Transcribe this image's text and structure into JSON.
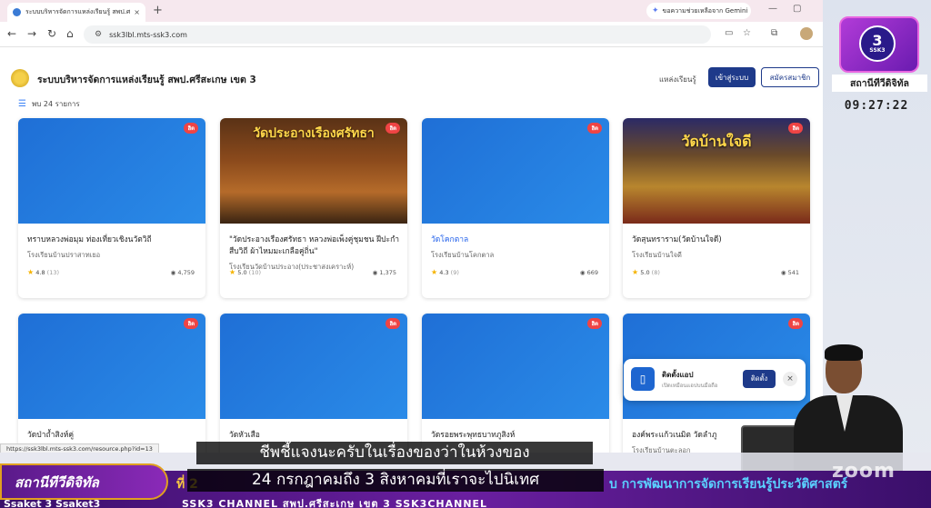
{
  "browser": {
    "tab_title": "ระบบบริหารจัดการแหล่งเรียนรู้ สพป.ศ",
    "tab_close": "×",
    "new_tab": "+",
    "gemini_label": "ขอความช่วยเหลือจาก Gemini",
    "url": "ssk3lbl.mts-ssk3.com",
    "status_url": "https://ssk3lbl.mts-ssk3.com/resource.php?id=13"
  },
  "site": {
    "title": "ระบบบริหารจัดการแหล่งเรียนรู้ สพป.ศรีสะเกษ เขต 3",
    "nav_link": "แหล่งเรียนรู้",
    "login_label": "เข้าสู่ระบบ",
    "register_label": "สมัครสมาชิก",
    "result_count": "พบ 24 รายการ"
  },
  "cards": [
    {
      "badge": "ฮิต",
      "name": "ทราบหลวงพ่อมุม ท่องเที่ยวเชิงนวัตวิถี",
      "school": "โรงเรียนบ้านปราสาทเยอ",
      "rating": "4.8",
      "reviews": "(13)",
      "views": "4,759",
      "poster": ""
    },
    {
      "badge": "ฮิต",
      "name": "\"วัดประอางเรืองศรัทธา หลวงพ่อเพ็งคู่ชุมชน ฝีปะกำสืบวิถี ผ้าไหมมะเกลือคู่ถิ่น\"",
      "school": "โรงเรียนวัดบ้านประอาง(ประชาสงเคราะห์)",
      "rating": "5.0",
      "reviews": "(10)",
      "views": "1,375",
      "poster": "วัดประอางเรืองศรัทธา"
    },
    {
      "badge": "ฮิต",
      "name": "วัดโคกตาล",
      "school": "โรงเรียนบ้านโคกตาล",
      "rating": "4.3",
      "reviews": "(9)",
      "views": "669",
      "poster": ""
    },
    {
      "badge": "ฮิต",
      "name": "วัดสุนทราราม(วัดบ้านใจดี)",
      "school": "โรงเรียนบ้านใจดี",
      "rating": "5.0",
      "reviews": "(8)",
      "views": "541",
      "poster": "วัดบ้านใจดี"
    },
    {
      "badge": "ฮิต",
      "name": "วัดป่าถ้ำสิงห์คู่",
      "school": "",
      "rating": "",
      "reviews": "",
      "views": "",
      "poster": ""
    },
    {
      "badge": "ฮิต",
      "name": "วัดหัวเสือ",
      "school": "",
      "rating": "",
      "reviews": "",
      "views": "",
      "poster": ""
    },
    {
      "badge": "ฮิต",
      "name": "วัดรอยพระพุทธบาทภูสิงห์",
      "school": "",
      "rating": "",
      "reviews": "",
      "views": "",
      "poster": ""
    },
    {
      "badge": "ฮิต",
      "name": "องค์พระแก้วเนมิต วัดลำภู",
      "school": "โรงเรียนบ้านตะลอก",
      "rating": "",
      "reviews": "",
      "views": "",
      "poster": ""
    }
  ],
  "install": {
    "title": "ติดตั้งแอป",
    "desc": "เปิดเหมือนแอปบนมือถือ",
    "button": "ติดตั้ง",
    "close": "×"
  },
  "broadcast": {
    "channel_name": "สถานีทีวีดิจิทัล",
    "clock": "09:27:22",
    "lower_tag": "สถานีทีวีดิจิทัล",
    "ticker_left": "ที่ 2",
    "ticker_right": "บ การพัฒนาการจัดการเรียนรู้ประวัติศาสตร์",
    "social": "SSK3 CHANNEL   สพป.ศรีสะเกษ เขต 3   SSK3CHANNEL",
    "slogan": "Ssaket 3 Ssaket3",
    "watermark": "zoom",
    "subtitle_1": "ชีพชี้แจงนะครับในเรื่องของว่าในห้วงของ",
    "subtitle_2": "24 กรกฎาคมถึง 3 สิงหาคมที่เราจะไปนิเทศ"
  }
}
